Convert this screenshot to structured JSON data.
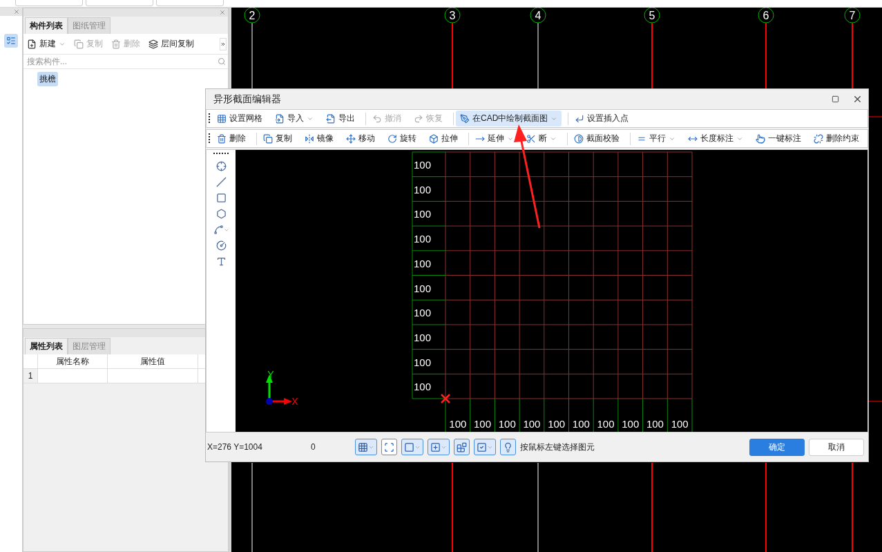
{
  "component_panel": {
    "tabs": [
      {
        "label": "构件列表",
        "selected": true
      },
      {
        "label": "图纸管理",
        "selected": false
      }
    ],
    "toolbar": [
      {
        "kind": "new",
        "label": "新建",
        "dropdown": true,
        "disabled": false
      },
      {
        "kind": "copy",
        "label": "复制",
        "dropdown": false,
        "disabled": true
      },
      {
        "kind": "delete",
        "label": "删除",
        "dropdown": false,
        "disabled": true
      },
      {
        "kind": "layers",
        "label": "层间复制",
        "dropdown": false,
        "disabled": false
      }
    ],
    "search": {
      "placeholder": "搜索构件..."
    },
    "tree": [
      {
        "label": "挑檐",
        "selected": true
      }
    ]
  },
  "property_panel": {
    "tabs": [
      {
        "label": "属性列表",
        "selected": true
      },
      {
        "label": "图层管理",
        "selected": false
      }
    ],
    "columns": [
      "属性名称",
      "属性值"
    ],
    "rows": [
      {
        "number": "1"
      }
    ]
  },
  "cad_canvas": {
    "axes": [
      {
        "label": "2",
        "color": "#808080"
      },
      {
        "label": "3",
        "color": "#ff0000"
      },
      {
        "label": "4",
        "color": "#808080"
      },
      {
        "label": "5",
        "color": "#ff0000"
      },
      {
        "label": "6",
        "color": "#ff0000"
      },
      {
        "label": "7",
        "color": "#ff0000"
      }
    ]
  },
  "dialog": {
    "title": "异形截面编辑器",
    "toolbar_1": [
      [
        {
          "kind": "grid",
          "label": "设置网格",
          "dropdown": false,
          "disabled": false,
          "active": false
        },
        {
          "kind": "import",
          "label": "导入",
          "dropdown": true,
          "disabled": false,
          "active": false
        },
        {
          "kind": "export",
          "label": "导出",
          "dropdown": false,
          "disabled": false,
          "active": false
        }
      ],
      [
        {
          "kind": "undo",
          "label": "撤消",
          "dropdown": false,
          "disabled": true,
          "active": false
        },
        {
          "kind": "redo",
          "label": "恢复",
          "dropdown": false,
          "disabled": true,
          "active": false
        }
      ],
      [
        {
          "kind": "cad",
          "label": "在CAD中绘制截面图",
          "dropdown": true,
          "disabled": false,
          "active": true
        }
      ],
      [
        {
          "kind": "insert",
          "label": "设置插入点",
          "dropdown": false,
          "disabled": false,
          "active": false
        }
      ]
    ],
    "toolbar_2": [
      [
        {
          "kind": "delete",
          "label": "删除",
          "dropdown": false,
          "disabled": false,
          "active": false
        }
      ],
      [
        {
          "kind": "copy",
          "label": "复制",
          "dropdown": false,
          "disabled": false,
          "active": false
        },
        {
          "kind": "mirror",
          "label": "镜像",
          "dropdown": false,
          "disabled": false,
          "active": false
        },
        {
          "kind": "move",
          "label": "移动",
          "dropdown": false,
          "disabled": false,
          "active": false
        },
        {
          "kind": "rotate",
          "label": "旋转",
          "dropdown": false,
          "disabled": false,
          "active": false
        },
        {
          "kind": "stretch",
          "label": "拉伸",
          "dropdown": false,
          "disabled": false,
          "active": false
        }
      ],
      [
        {
          "kind": "extend",
          "label": "延伸",
          "dropdown": true,
          "disabled": false,
          "active": false
        },
        {
          "kind": "break",
          "label": "断",
          "dropdown": true,
          "disabled": false,
          "active": false
        }
      ],
      [
        {
          "kind": "check",
          "label": "截面校验",
          "dropdown": false,
          "disabled": false,
          "active": false
        }
      ],
      [
        {
          "kind": "parallel",
          "label": "平行",
          "dropdown": true,
          "disabled": false,
          "active": false
        },
        {
          "kind": "dimension",
          "label": "长度标注",
          "dropdown": true,
          "disabled": false,
          "active": false
        },
        {
          "kind": "autodim",
          "label": "一键标注",
          "dropdown": false,
          "disabled": false,
          "active": false
        },
        {
          "kind": "unconstrain",
          "label": "删除约束",
          "dropdown": false,
          "disabled": false,
          "active": false
        }
      ]
    ],
    "tools": [
      {
        "kind": "point",
        "dropdown": false
      },
      {
        "kind": "line",
        "dropdown": false
      },
      {
        "kind": "rect",
        "dropdown": false
      },
      {
        "kind": "polygon",
        "dropdown": false
      },
      {
        "kind": "arc",
        "dropdown": true
      },
      {
        "kind": "circle",
        "dropdown": false
      },
      {
        "kind": "text",
        "dropdown": false
      }
    ],
    "grid": {
      "row_labels": [
        "100",
        "100",
        "100",
        "100",
        "100",
        "100",
        "100",
        "100",
        "100",
        "100"
      ],
      "column_labels": [
        "100",
        "100",
        "100",
        "100",
        "100",
        "100",
        "100",
        "100",
        "100",
        "100"
      ]
    },
    "axis_labels": {
      "x": "X",
      "y": "Y"
    },
    "status": {
      "coordinates": "X=276 Y=1004",
      "value": "0",
      "hint": "按鼠标左键选择图元"
    },
    "status_tools": [
      {
        "kind": "grid",
        "dropdown": true,
        "on": true
      },
      {
        "kind": "ortho",
        "dropdown": false,
        "on": false
      },
      {
        "kind": "snap",
        "dropdown": true,
        "on": true
      },
      {
        "kind": "offset",
        "dropdown": true,
        "on": true
      },
      {
        "kind": "blocks",
        "dropdown": false,
        "on": true
      },
      {
        "kind": "check",
        "dropdown": true,
        "on": true
      },
      {
        "kind": "bulb",
        "dropdown": false,
        "on": true
      }
    ],
    "buttons": [
      {
        "label": "确定",
        "primary": true
      },
      {
        "label": "取消",
        "primary": false
      }
    ]
  }
}
